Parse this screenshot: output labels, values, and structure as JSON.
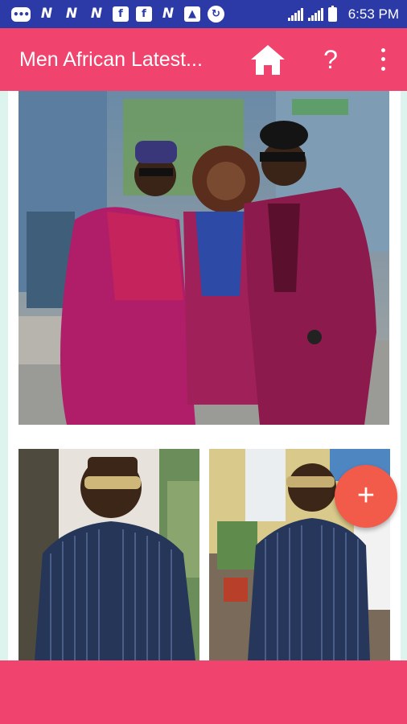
{
  "status_bar": {
    "notification_icons": [
      {
        "name": "chat-icon",
        "glyph": "•••",
        "style": "round-box"
      },
      {
        "name": "n-app-icon",
        "glyph": "N",
        "style": "plain"
      },
      {
        "name": "n-app-icon",
        "glyph": "N",
        "style": "plain"
      },
      {
        "name": "n-app-icon",
        "glyph": "N",
        "style": "plain"
      },
      {
        "name": "facebook-icon",
        "glyph": "f",
        "style": "boxed"
      },
      {
        "name": "facebook-icon",
        "glyph": "f",
        "style": "boxed"
      },
      {
        "name": "n-app-icon",
        "glyph": "N",
        "style": "plain"
      },
      {
        "name": "image-icon",
        "glyph": "▲",
        "style": "boxed"
      },
      {
        "name": "sync-icon",
        "glyph": "↻",
        "style": "circle"
      }
    ],
    "time": "6:53 PM"
  },
  "app_bar": {
    "title": "Men African Latest...",
    "home_icon": "home-icon",
    "help_label": "?",
    "overflow_icon": "more-vert-icon"
  },
  "gallery": {
    "photos": [
      {
        "name": "group-photo",
        "description_icon": "photo"
      },
      {
        "name": "blue-outfit-photo-1",
        "description_icon": "photo"
      },
      {
        "name": "blue-outfit-photo-2",
        "description_icon": "photo"
      }
    ]
  },
  "fab": {
    "label": "+"
  },
  "colors": {
    "status_bar": "#2c3aa8",
    "primary": "#f0446e",
    "accent": "#f25a4a",
    "content_bg": "#ddf3ed"
  }
}
